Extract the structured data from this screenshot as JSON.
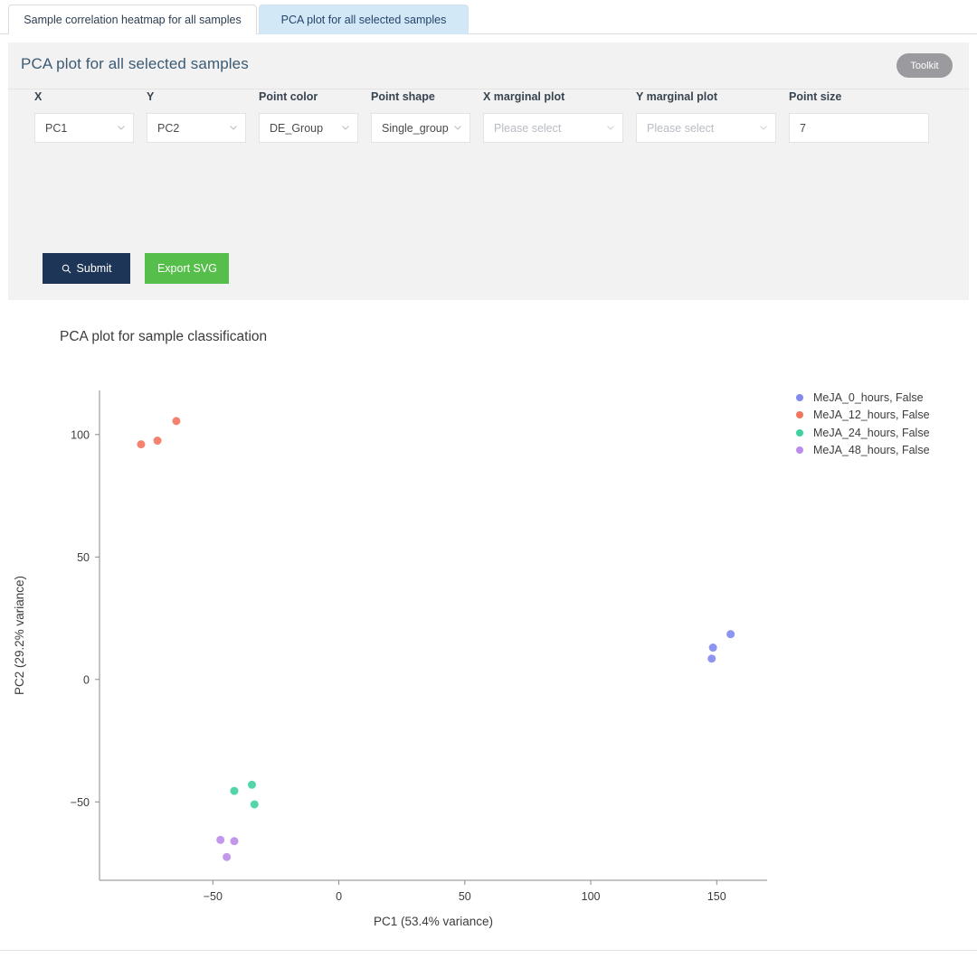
{
  "tabs": [
    {
      "label": "Sample correlation heatmap for all samples",
      "active": false
    },
    {
      "label": "PCA plot for all selected samples",
      "active": true
    }
  ],
  "panel": {
    "title": "PCA plot for all selected samples",
    "toolkit_label": "Toolkit"
  },
  "form": {
    "fields": [
      {
        "label": "X",
        "value": "PC1",
        "type": "select",
        "placeholder": false
      },
      {
        "label": "Y",
        "value": "PC2",
        "type": "select",
        "placeholder": false
      },
      {
        "label": "Point color",
        "value": "DE_Group",
        "type": "select",
        "placeholder": false
      },
      {
        "label": "Point shape",
        "value": "Single_group",
        "type": "select",
        "placeholder": false
      },
      {
        "label": "X marginal plot",
        "value": "Please select",
        "type": "select",
        "placeholder": true
      },
      {
        "label": "Y marginal plot",
        "value": "Please select",
        "type": "select",
        "placeholder": true
      },
      {
        "label": "Point size",
        "value": "7",
        "type": "text",
        "placeholder": false
      }
    ]
  },
  "actions": {
    "submit_label": "Submit",
    "submit_icon": "search-icon",
    "export_label": "Export SVG"
  },
  "colors": {
    "tab_active_bg": "#d3e8f6",
    "panel_bg": "#f2f2f2",
    "submit_bg": "#1d3557",
    "export_bg": "#56be4a",
    "toolkit_bg": "#9a9a9f"
  },
  "chart_data": {
    "type": "scatter",
    "title": "PCA plot for sample classification",
    "xlabel": "PC1 (53.4% variance)",
    "ylabel": "PC2 (29.2% variance)",
    "xlim": [
      -95,
      170
    ],
    "ylim": [
      -82,
      118
    ],
    "xticks": [
      -50,
      0,
      50,
      100,
      150
    ],
    "yticks": [
      -50,
      0,
      50,
      100
    ],
    "grid": false,
    "legend_position": "right",
    "series": [
      {
        "name": "MeJA_0_hours, False",
        "color": "#8189ee",
        "points": [
          [
            148.5,
            13.0
          ],
          [
            148.0,
            8.5
          ],
          [
            155.5,
            18.5
          ]
        ]
      },
      {
        "name": "MeJA_12_hours, False",
        "color": "#f4745e",
        "points": [
          [
            -78.5,
            96.0
          ],
          [
            -72.0,
            97.5
          ],
          [
            -64.5,
            105.5
          ]
        ]
      },
      {
        "name": "MeJA_24_hours, False",
        "color": "#3fd1a0",
        "points": [
          [
            -41.5,
            -45.5
          ],
          [
            -34.5,
            -43.0
          ],
          [
            -33.5,
            -51.0
          ]
        ]
      },
      {
        "name": "MeJA_48_hours, False",
        "color": "#bb8cea",
        "points": [
          [
            -47.0,
            -65.5
          ],
          [
            -41.5,
            -66.0
          ],
          [
            -44.5,
            -72.5
          ]
        ]
      }
    ]
  }
}
